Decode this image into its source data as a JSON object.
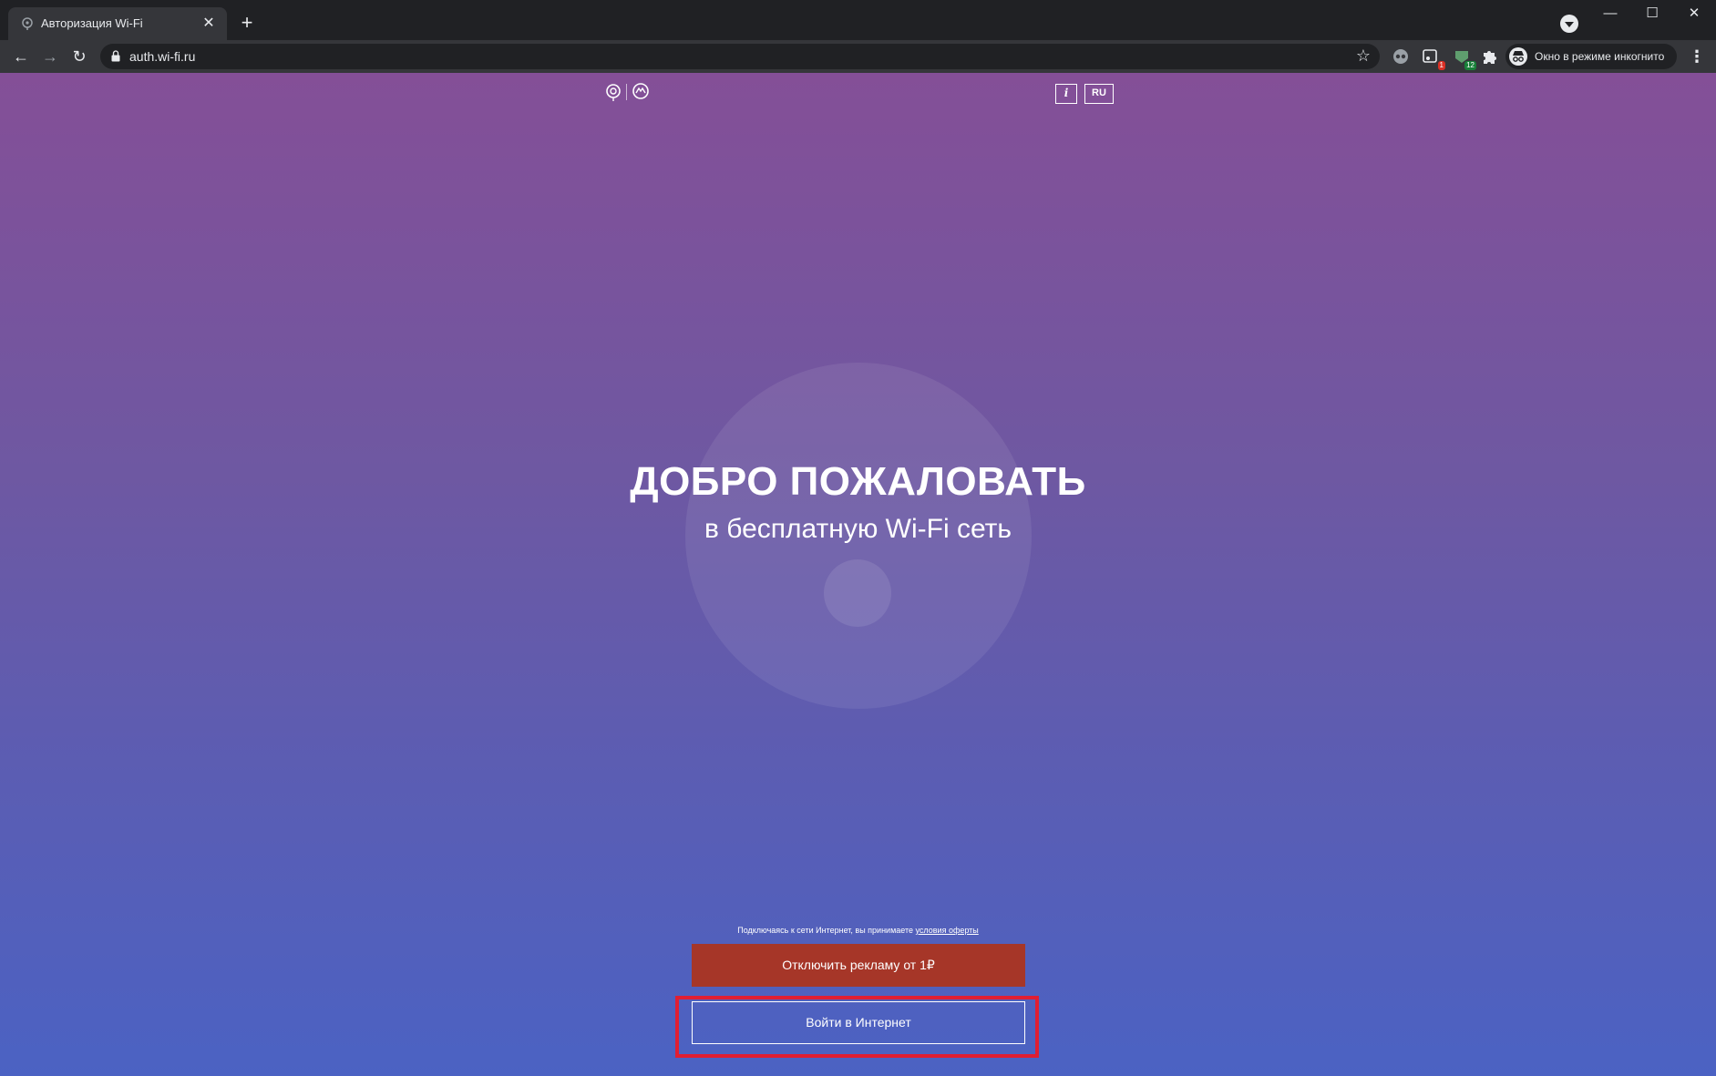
{
  "browser": {
    "tab_title": "Авторизация Wi-Fi",
    "url": "auth.wi-fi.ru",
    "incognito_label": "Окно в режиме инкогнито",
    "extensions": [
      {
        "name": "ext-eye-icon",
        "badge": ""
      },
      {
        "name": "ext-red-badge-icon",
        "badge": "1",
        "badge_color": "#d93025"
      },
      {
        "name": "ext-green-badge-icon",
        "badge": "12",
        "badge_color": "#188038"
      },
      {
        "name": "extensions-puzzle-icon",
        "badge": ""
      }
    ]
  },
  "page": {
    "lang": "RU",
    "info": "i",
    "title": "ДОБРО ПОЖАЛОВАТЬ",
    "subtitle": "в бесплатную Wi-Fi сеть",
    "terms_text": "Подключаясь к сети Интернет, вы принимаете ",
    "terms_link": "условия оферты",
    "ad_button": "Отключить рекламу от 1₽",
    "login_button": "Войти в Интернет",
    "colors": {
      "gradient_top": "#844f97",
      "gradient_bottom": "#4b62c3",
      "ad_button": "#a63628",
      "highlight": "#e01e32"
    }
  }
}
